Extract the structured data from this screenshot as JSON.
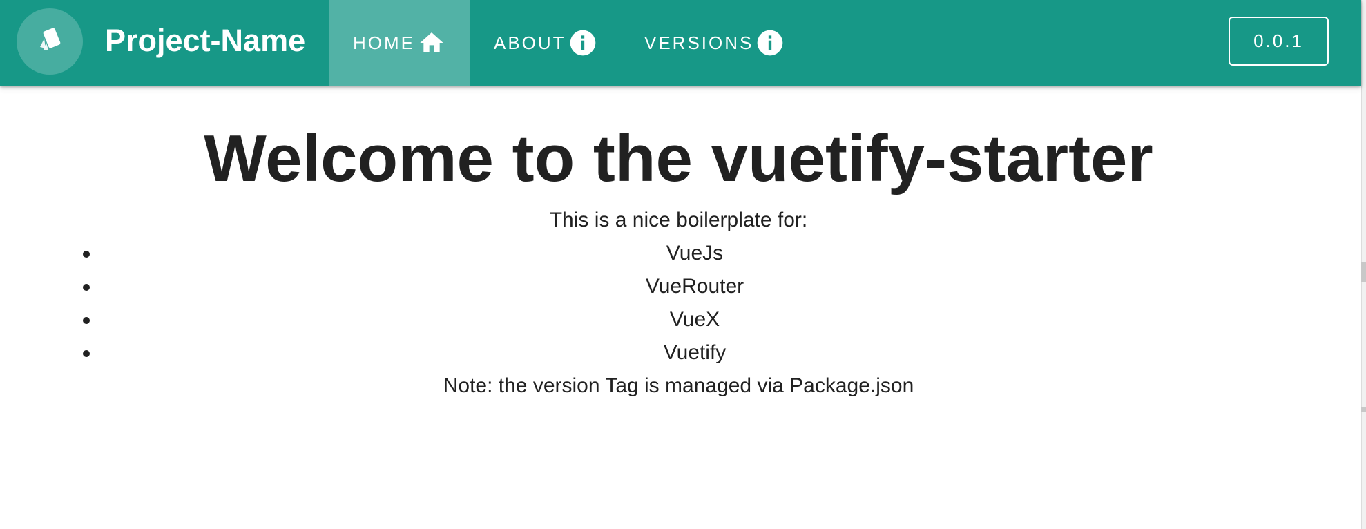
{
  "colors": {
    "primary": "#179887",
    "active_tab": "#52b2a6",
    "logo_circle": "#47ada0",
    "text": "#212121"
  },
  "appbar": {
    "logo_icon": "cards-icon",
    "title": "Project-Name",
    "nav": [
      {
        "label": "HOME",
        "icon": "home-icon",
        "active": true
      },
      {
        "label": "ABOUT",
        "icon": "info-icon",
        "active": false
      },
      {
        "label": "VERSIONS",
        "icon": "info-icon",
        "active": false
      }
    ],
    "version_tag": "0.0.1"
  },
  "main": {
    "headline": "Welcome to the vuetify-starter",
    "intro": "This is a nice boilerplate for:",
    "list": [
      "VueJs",
      "VueRouter",
      "VueX",
      "Vuetify"
    ],
    "note": "Note: the version Tag is managed via Package.json"
  }
}
